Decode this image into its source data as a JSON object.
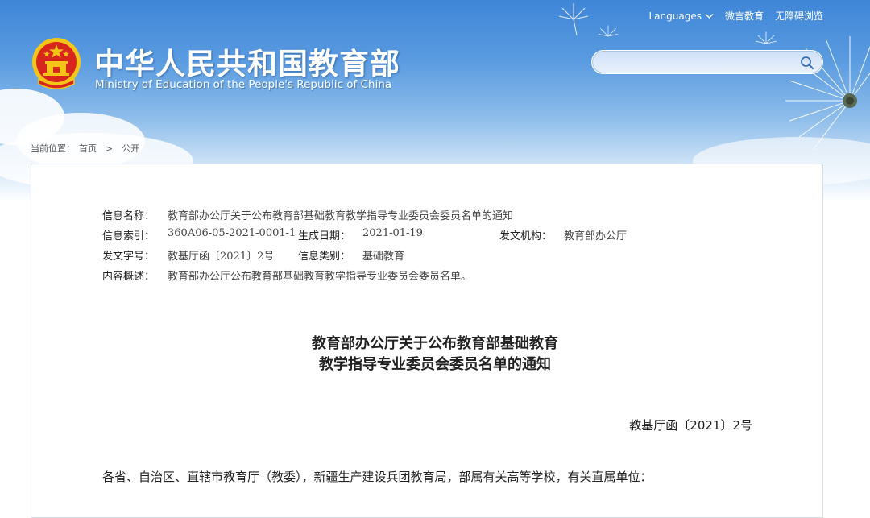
{
  "header": {
    "site_title": "中华人民共和国教育部",
    "site_title_en": "Ministry of Education of the People's Republic of China",
    "top_links": {
      "languages": "Languages",
      "weibo": "微言教育",
      "accessibility": "无障碍浏览"
    },
    "search": {
      "placeholder": ""
    },
    "colors": {
      "sky_top": "#3f86d8",
      "sky_bottom": "#cfe3f6",
      "emblem_red": "#d7261e",
      "emblem_gold": "#f5c518"
    }
  },
  "breadcrumb": {
    "label": "当前位置：",
    "items": [
      "首页",
      "公开"
    ]
  },
  "meta": {
    "name": {
      "label": "信息名称：",
      "value": "教育部办公厅关于公布教育部基础教育教学指导专业委员会委员名单的通知"
    },
    "index": {
      "label": "信息索引：",
      "value": "360A06-05-2021-0001-1"
    },
    "date": {
      "label": "生成日期：",
      "value": "2021-01-19"
    },
    "org": {
      "label": "发文机构：",
      "value": "教育部办公厅"
    },
    "doc_no": {
      "label": "发文字号：",
      "value": "教基厅函〔2021〕2号"
    },
    "category": {
      "label": "信息类别：",
      "value": "基础教育"
    },
    "summary": {
      "label": "内容概述：",
      "value": "教育部办公厅公布教育部基础教育教学指导专业委员会委员名单。"
    }
  },
  "document": {
    "title_line1": "教育部办公厅关于公布教育部基础教育",
    "title_line2": "教学指导专业委员会委员名单的通知",
    "doc_number": "教基厅函〔2021〕2号",
    "salutation": "各省、自治区、直辖市教育厅（教委），新疆生产建设兵团教育局，部属有关高等学校，有关直属单位："
  }
}
